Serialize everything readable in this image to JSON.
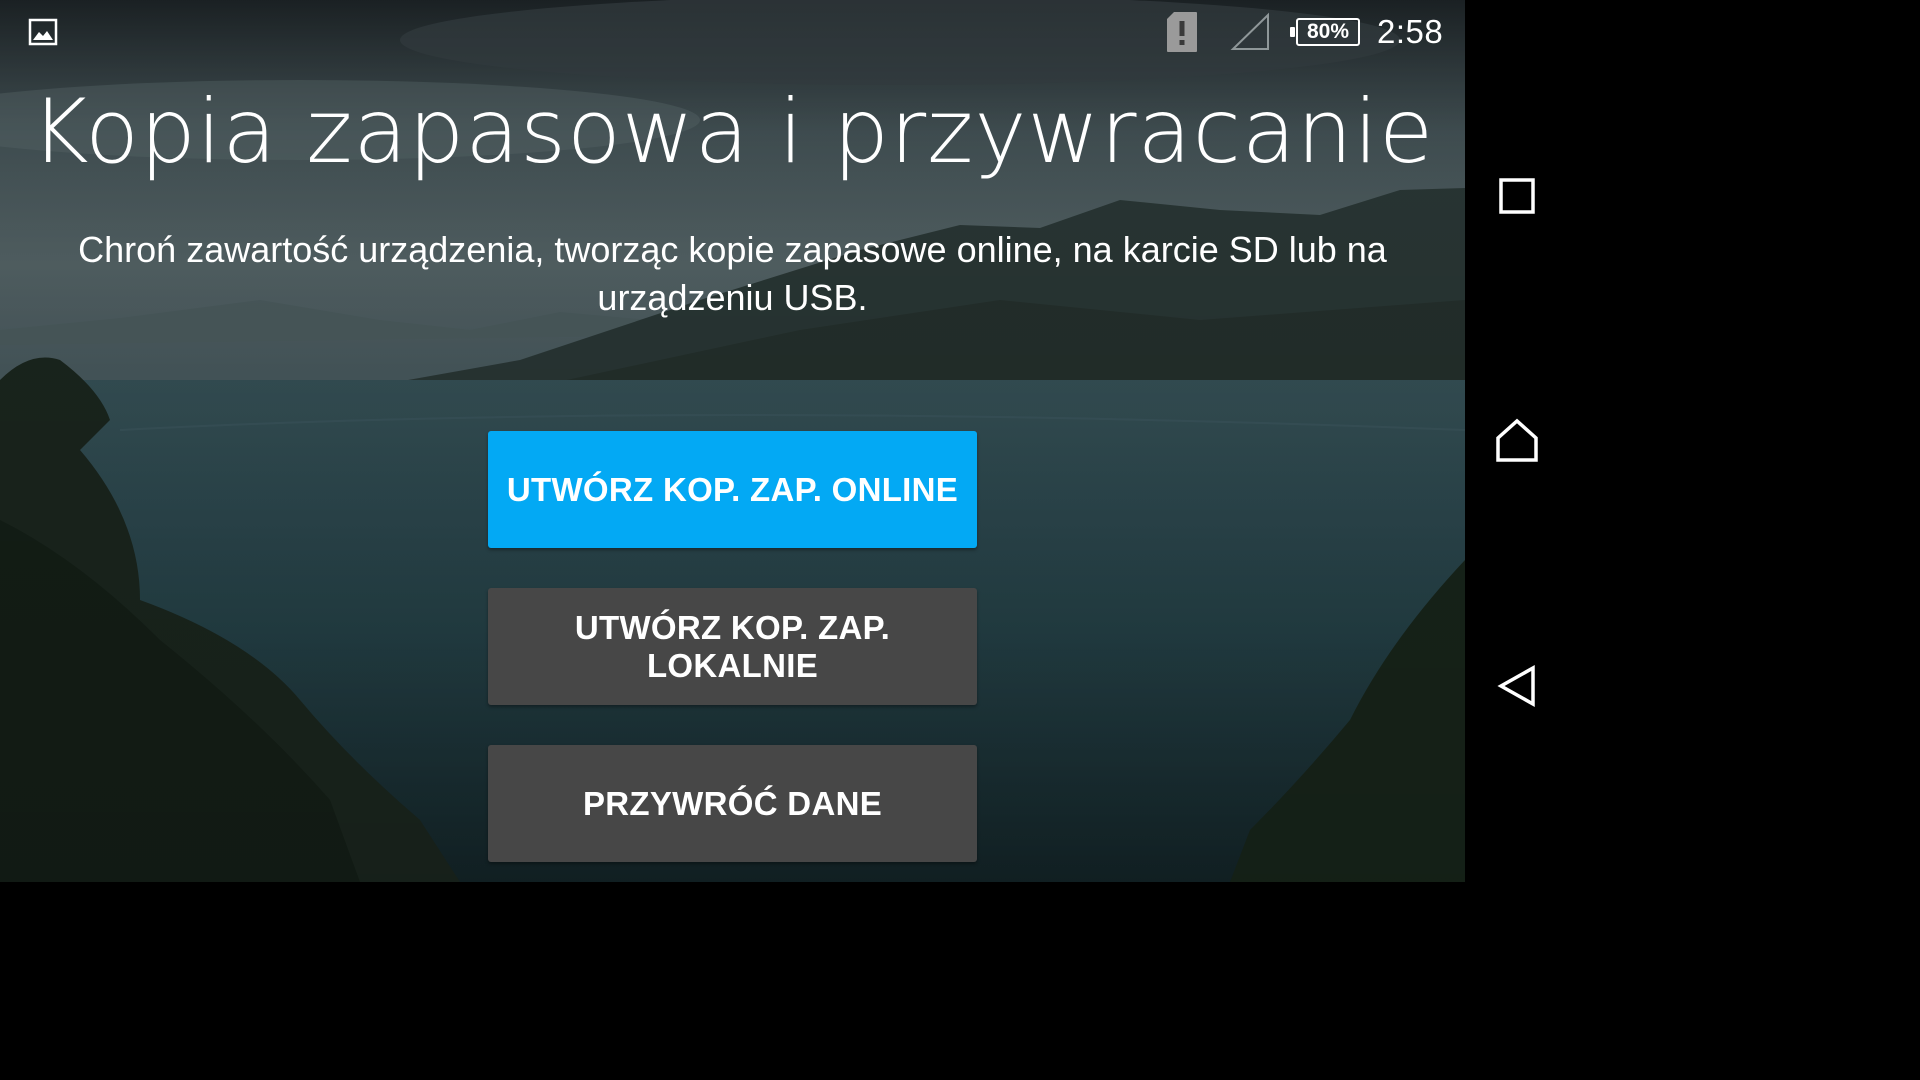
{
  "status_bar": {
    "notification_icon": "gallery-icon",
    "alert_icon": "sd-card-alert-icon",
    "signal_icon": "cell-signal-empty-icon",
    "battery_percent": "80%",
    "time": "2:58"
  },
  "main": {
    "title": "Kopia zapasowa i przywracanie",
    "description": "Chroń zawartość urządzenia, tworząc kopie zapasowe online, na karcie SD lub na urządzeniu USB.",
    "buttons": [
      {
        "label": "UTWÓRZ KOP. ZAP. ONLINE"
      },
      {
        "label": "UTWÓRZ KOP. ZAP. LOKALNIE"
      },
      {
        "label": "PRZYWRÓĆ DANE"
      }
    ]
  },
  "nav_bar": {
    "recents_icon": "square-recents-icon",
    "home_icon": "home-icon",
    "back_icon": "back-triangle-icon"
  },
  "colors": {
    "primary_button": "#03a9f4",
    "secondary_button": "#474747",
    "nav_background": "#000000"
  }
}
